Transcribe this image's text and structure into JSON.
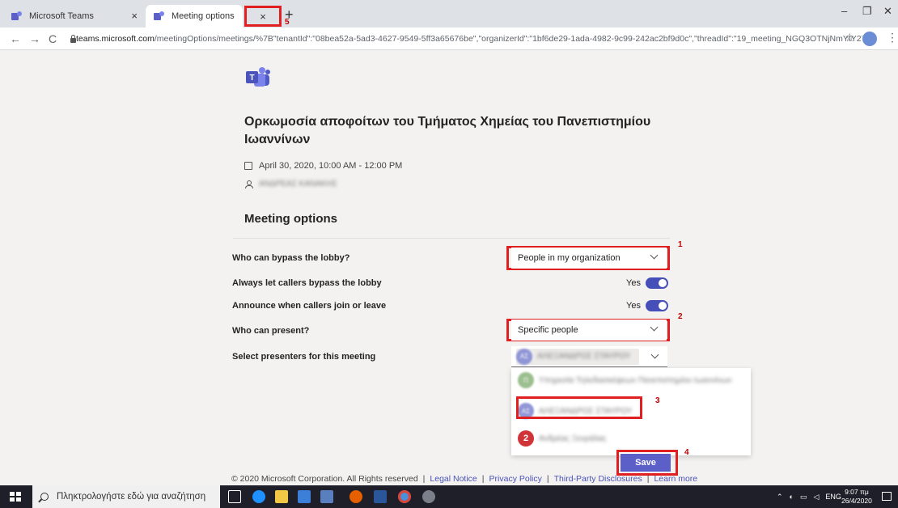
{
  "browser": {
    "tabs": [
      {
        "label": "Microsoft Teams"
      },
      {
        "label": "Meeting options"
      }
    ],
    "third_tab_close": "×",
    "new_tab": "+",
    "url_domain": "teams.microsoft.com",
    "url_path": "/meetingOptions/meetings/%7B\"tenantId\":\"08bea52a-5ad3-4627-9549-5ff3a65676be\",\"organizerId\":\"1bf6de29-1ada-4982-9c99-242ac2bf9d0c\",\"threadId\":\"19_meeting_NGQ3OTNjNmYtY2YxNy0..."
  },
  "meeting": {
    "title": "Ορκωμοσία αποφοίτων του Τμήματος Χημείας του Πανεπιστημίου Ιωαννίνων",
    "datetime": "April 30, 2020, 10:00 AM - 12:00 PM",
    "organizer": "ΑΝΔΡΕΑΣ ΚΑΝΑΚΗΣ"
  },
  "options": {
    "section_title": "Meeting options",
    "bypass_lobby": {
      "label": "Who can bypass the lobby?",
      "value": "People in my organization"
    },
    "callers_bypass": {
      "label": "Always let callers bypass the lobby",
      "value": "Yes"
    },
    "announce": {
      "label": "Announce when callers join or leave",
      "value": "Yes"
    },
    "who_present": {
      "label": "Who can present?",
      "value": "Specific people"
    },
    "select_presenters": {
      "label": "Select presenters for this meeting",
      "chip": {
        "initials": "ΑΣ",
        "name": "ΑΛΕΞΑΝΔΡΟΣ ΣΤΑΥΡΟΥ"
      }
    },
    "suggestions": [
      {
        "initials": "Π",
        "name": "Υπηρεσία Τηλεδιασκέψεων Πανεπιστημίου Ιωαννίνων"
      },
      {
        "initials": "ΑΣ",
        "name": "ΑΛΕΞΑΝΔΡΟΣ ΣΤΑΥΡΟΥ"
      },
      {
        "initials": "2",
        "name": "Ανδρέας Ξενράλας"
      }
    ],
    "save_label": "Save"
  },
  "annotations": {
    "m1": "1",
    "m2": "2",
    "m3": "3",
    "m4": "4",
    "m5": "5"
  },
  "footer": {
    "copyright": "© 2020 Microsoft Corporation. All Rights reserved",
    "links": [
      "Legal Notice",
      "Privacy Policy",
      "Third-Party Disclosures",
      "Learn more"
    ]
  },
  "taskbar": {
    "search_placeholder": "Πληκτρολογήστε εδώ για αναζήτηση",
    "lang": "ENG",
    "time": "9:07 πμ",
    "date": "26/4/2020"
  },
  "colors": {
    "accent": "#5b5fc7",
    "toggle": "#464eb8",
    "annotation": "#e02020"
  }
}
